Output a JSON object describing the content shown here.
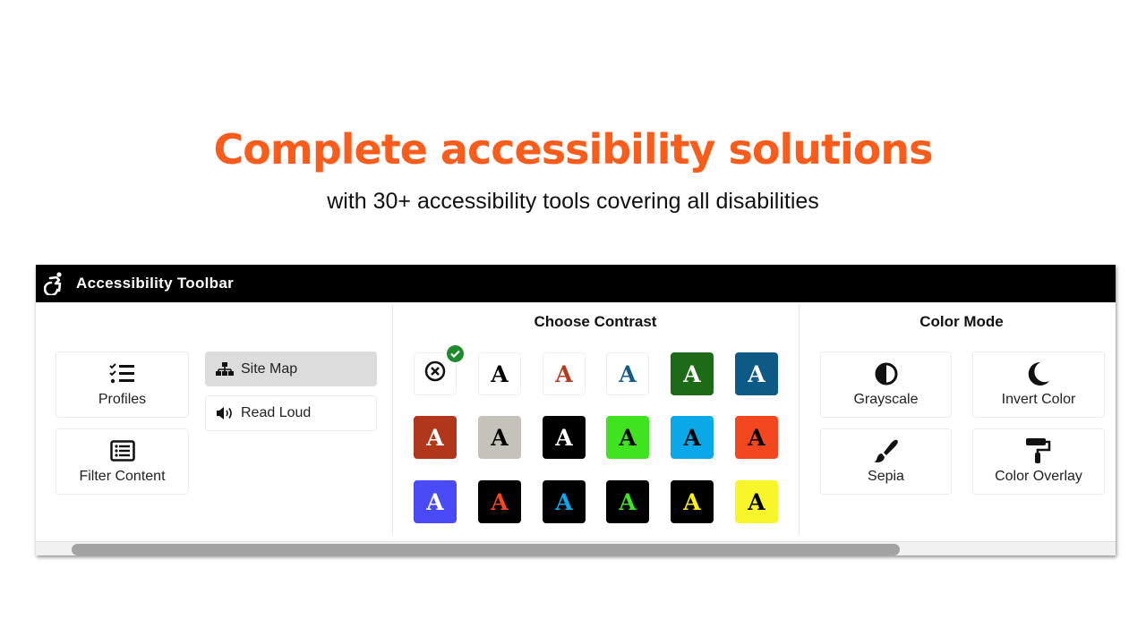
{
  "hero": {
    "title": "Complete accessibility solutions",
    "subtitle": "with 30+ accessibility tools covering all disabilities",
    "title_color": "#f95c1b"
  },
  "toolbar": {
    "title": "Accessibility Toolbar",
    "logo_icon": "accessible-icon",
    "left": {
      "cards": [
        {
          "label": "Profiles",
          "icon": "checklist-icon"
        },
        {
          "label": "Filter Content",
          "icon": "list-box-icon"
        }
      ],
      "row_buttons": [
        {
          "label": "Site Map",
          "icon": "sitemap-icon",
          "active": true
        },
        {
          "label": "Read Loud",
          "icon": "volume-icon",
          "active": false
        }
      ]
    },
    "contrast": {
      "title": "Choose Contrast",
      "selected_index": 0,
      "swatches": [
        {
          "bg": "#ffffff",
          "fg": "#000000",
          "type": "reset",
          "icon": "reset-x-icon"
        },
        {
          "bg": "#ffffff",
          "fg": "#000000",
          "letter": "A"
        },
        {
          "bg": "#ffffff",
          "fg": "#b73b1e",
          "letter": "A"
        },
        {
          "bg": "#ffffff",
          "fg": "#145c85",
          "letter": "A"
        },
        {
          "bg": "#1d6b17",
          "fg": "#ffffff",
          "letter": "A"
        },
        {
          "bg": "#0e5a86",
          "fg": "#ffffff",
          "letter": "A"
        },
        {
          "bg": "#b0371c",
          "fg": "#ffffff",
          "letter": "A"
        },
        {
          "bg": "#c5c2bb",
          "fg": "#000000",
          "letter": "A"
        },
        {
          "bg": "#000000",
          "fg": "#ffffff",
          "letter": "A"
        },
        {
          "bg": "#3fe31f",
          "fg": "#000000",
          "letter": "A"
        },
        {
          "bg": "#0aa8e8",
          "fg": "#000000",
          "letter": "A"
        },
        {
          "bg": "#f5471f",
          "fg": "#000000",
          "letter": "A"
        },
        {
          "bg": "#4a4af7",
          "fg": "#ffffff",
          "letter": "A"
        },
        {
          "bg": "#000000",
          "fg": "#f5471f",
          "letter": "A"
        },
        {
          "bg": "#000000",
          "fg": "#0aa8e8",
          "letter": "A"
        },
        {
          "bg": "#000000",
          "fg": "#3fe31f",
          "letter": "A"
        },
        {
          "bg": "#000000",
          "fg": "#f8f010",
          "letter": "A"
        },
        {
          "bg": "#f8f52a",
          "fg": "#000000",
          "letter": "A"
        }
      ],
      "check_color": "#1e8a2e"
    },
    "color_mode": {
      "title": "Color Mode",
      "cards": [
        {
          "label": "Grayscale",
          "icon": "half-circle-contrast-icon"
        },
        {
          "label": "Invert Color",
          "icon": "moon-icon"
        },
        {
          "label": "Sepia",
          "icon": "paintbrush-icon"
        },
        {
          "label": "Color Overlay",
          "icon": "paint-roller-icon"
        }
      ]
    }
  }
}
